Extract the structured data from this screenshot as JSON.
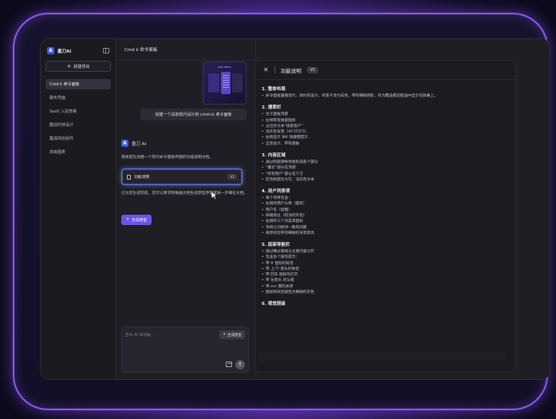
{
  "sidebar": {
    "brand": "墨刀AI",
    "new_project": "新建项目",
    "items": [
      {
        "label": "Cmd k 命令面板",
        "active": true
      },
      {
        "label": "聊天界面",
        "active": false
      },
      {
        "label": "SaaS 入驻表格",
        "active": false
      },
      {
        "label": "酷炫时钟设计",
        "active": false
      },
      {
        "label": "集成商店组件",
        "active": false
      },
      {
        "label": "高级图表",
        "active": false
      }
    ]
  },
  "chat": {
    "title": "Cmd k 命令面板",
    "thumbnail_title": "CMD MENU",
    "user_message": "创建一个具有现代设计的 cmd+k 命令面板",
    "ai_name": "墨刀 AI",
    "ai_message": "我将首先创建一个现代命令面板界面的功能说明文档。",
    "doc_card_label": "功能说明",
    "doc_card_version": "V1",
    "ai_followup": "已为您生成完成，您可以要求我根据文档生成原型界面或进一步细化文档。",
    "generate_button": "生成原型",
    "composer_placeholder": "告诉 AI 如何做...",
    "composer_generate": "生成原型"
  },
  "doc": {
    "title": "功能说明",
    "version": "V1",
    "sections": [
      {
        "title": "1. 整体布局",
        "items": [
          "命令面板遵循现代、简约的设计，背景干净为白色，带有细微阴影，作为覆盖模态框居中显示在屏幕上。"
        ]
      },
      {
        "title": "2. 搜索栏",
        "items": [
          "位于面板顶部",
          "左侧带有搜索图标",
          "占位符文本“搜索客户”",
          "浅灰色背景（#F5F5F5）",
          "右侧显示 ⌘K 快捷键提示",
          "全宽设计，带有圆角"
        ]
      },
      {
        "title": "3. 内容区域",
        "items": [
          "通过标题清晰地组织成各个部分",
          "“最近”部分在顶部",
          "“所有用户”部分在下方",
          "区块标题为大写、浅灰色文本"
        ]
      },
      {
        "title": "4. 用户列表项",
        "items": [
          "每个项目包含：",
          "左侧的用户头像（圆形）",
          "用户名（加粗）",
          "邮箱地址（较浅的灰色）",
          "右侧的三个点菜单图标",
          "项目之间保持一致的间距",
          "悬停状态带有细微的背景高亮"
        ]
      },
      {
        "title": "5. 底部导航栏",
        "items": [
          "通过细分隔线与主要内容分开",
          "包含多个操作提示：",
          "带 # 图标的标签",
          "带 上/下 箭头的导航",
          "带 回车 图标的打开",
          "带 左箭头 的父级",
          "带 esc 键的关闭",
          "图标和标签颜色为细微的灰色"
        ]
      },
      {
        "title": "6. 视觉层级",
        "items": []
      }
    ]
  }
}
